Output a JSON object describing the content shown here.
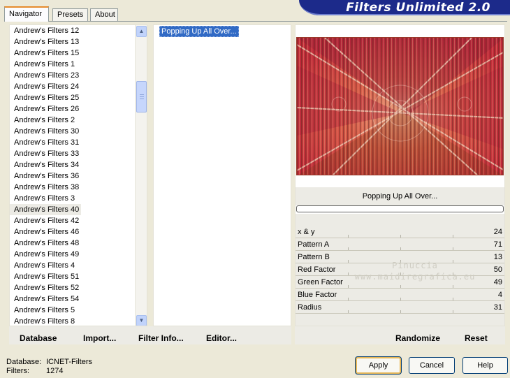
{
  "banner": {
    "title": "Filters Unlimited 2.0"
  },
  "tabs": [
    {
      "label": "Navigator",
      "active": true
    },
    {
      "label": "Presets",
      "active": false
    },
    {
      "label": "About",
      "active": false
    }
  ],
  "categories": {
    "items": [
      "Andrew's Filters 12",
      "Andrew's Filters 13",
      "Andrew's Filters 15",
      "Andrew's Filters 1",
      "Andrew's Filters 23",
      "Andrew's Filters 24",
      "Andrew's Filters 25",
      "Andrew's Filters 26",
      "Andrew's Filters 2",
      "Andrew's Filters 30",
      "Andrew's Filters 31",
      "Andrew's Filters 33",
      "Andrew's Filters 34",
      "Andrew's Filters 36",
      "Andrew's Filters 38",
      "Andrew's Filters 3",
      "Andrew's Filters 40",
      "Andrew's Filters 42",
      "Andrew's Filters 46",
      "Andrew's Filters 48",
      "Andrew's Filters 49",
      "Andrew's Filters 4",
      "Andrew's Filters 51",
      "Andrew's Filters 52",
      "Andrew's Filters 54",
      "Andrew's Filters 5",
      "Andrew's Filters 8"
    ],
    "selected_index": 16
  },
  "filters": {
    "items": [
      "Popping Up All Over..."
    ],
    "selected_index": 0
  },
  "preview": {
    "filter_name": "Popping Up All Over..."
  },
  "params": [
    {
      "label": "x & y",
      "value": "24"
    },
    {
      "label": "Pattern A",
      "value": "71"
    },
    {
      "label": "Pattern B",
      "value": "13"
    },
    {
      "label": "Red Factor",
      "value": "50"
    },
    {
      "label": "Green Factor",
      "value": "49"
    },
    {
      "label": "Blue Factor",
      "value": "4"
    },
    {
      "label": "Radius",
      "value": "31"
    }
  ],
  "watermark": {
    "line1": "Pinuccia",
    "line2": "www.maidiregrafica.eu"
  },
  "actions_left": {
    "database": "Database",
    "import": "Import...",
    "filter_info": "Filter Info...",
    "editor": "Editor..."
  },
  "actions_right": {
    "randomize": "Randomize",
    "reset": "Reset"
  },
  "info": {
    "database_label": "Database:",
    "database_value": "ICNET-Filters",
    "filters_label": "Filters:",
    "filters_value": "1274"
  },
  "buttons": {
    "apply": "Apply",
    "cancel": "Cancel",
    "help": "Help"
  },
  "colors": {
    "banner": "#1c2a8a",
    "selection": "#316ac5",
    "tab_highlight": "#e68b2c"
  }
}
